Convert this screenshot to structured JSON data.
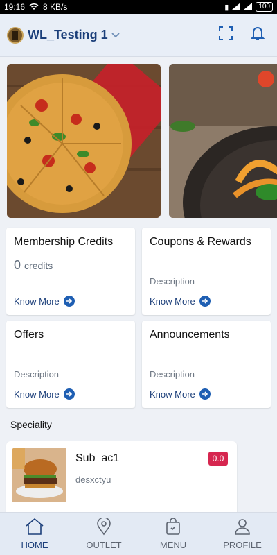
{
  "status_bar": {
    "time": "19:16",
    "speed": "8 KB/s",
    "battery": "100"
  },
  "header": {
    "store_name": "WL_Testing 1",
    "icons": [
      "store-logo-icon",
      "chevron-down-icon",
      "scan-icon",
      "bell-icon"
    ]
  },
  "colors": {
    "accent": "#1c3f7a",
    "arrow_button": "#1f5fb3",
    "badge": "#d6264f",
    "background": "#eef1f6"
  },
  "cards": {
    "membership": {
      "title": "Membership Credits",
      "credits_value": "0",
      "credits_unit": "credits",
      "link": "Know More"
    },
    "coupons": {
      "title": "Coupons & Rewards",
      "description": "Description",
      "link": "Know More"
    },
    "offers": {
      "title": "Offers",
      "description": "Description",
      "link": "Know More"
    },
    "announcements": {
      "title": "Announcements",
      "description": "Description",
      "link": "Know More"
    }
  },
  "speciality": {
    "heading": "Speciality",
    "item": {
      "name": "Sub_ac1",
      "description": "desxctyu",
      "price": "0.0"
    }
  },
  "bottom_nav": {
    "items": [
      {
        "label": "HOME",
        "icon": "home-icon",
        "active": true
      },
      {
        "label": "OUTLET",
        "icon": "location-pin-icon",
        "active": false
      },
      {
        "label": "MENU",
        "icon": "shopping-bag-icon",
        "active": false
      },
      {
        "label": "PROFILE",
        "icon": "person-icon",
        "active": false
      }
    ]
  }
}
